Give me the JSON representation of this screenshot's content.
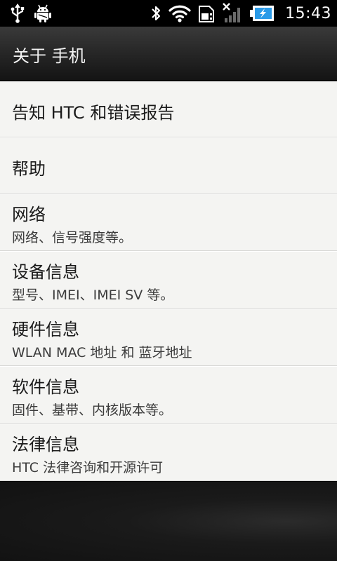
{
  "status_bar": {
    "time": "15:43",
    "icons": [
      "usb-icon",
      "android-debug-icon",
      "bluetooth-icon",
      "wifi-icon",
      "sim-icon",
      "no-signal-icon",
      "battery-charging-icon"
    ]
  },
  "title_bar": {
    "title": "关于 手机"
  },
  "list": {
    "items": [
      {
        "title": "告知 HTC 和错误报告",
        "subtitle": ""
      },
      {
        "title": "帮助",
        "subtitle": ""
      },
      {
        "title": "网络",
        "subtitle": "网络、信号强度等。"
      },
      {
        "title": "设备信息",
        "subtitle": "型号、IMEI、IMEI SV 等。"
      },
      {
        "title": "硬件信息",
        "subtitle": "WLAN MAC 地址 和 蓝牙地址"
      },
      {
        "title": "软件信息",
        "subtitle": "固件、基带、内核版本等。"
      },
      {
        "title": "法律信息",
        "subtitle": "HTC 法律咨询和开源许可"
      }
    ]
  },
  "colors": {
    "list_bg": "#f4f4f2",
    "divider": "#d6d6d4",
    "title_text": "#1a1a1a",
    "sub_text": "#3c3c3c",
    "battery_fill": "#2b9be8"
  }
}
